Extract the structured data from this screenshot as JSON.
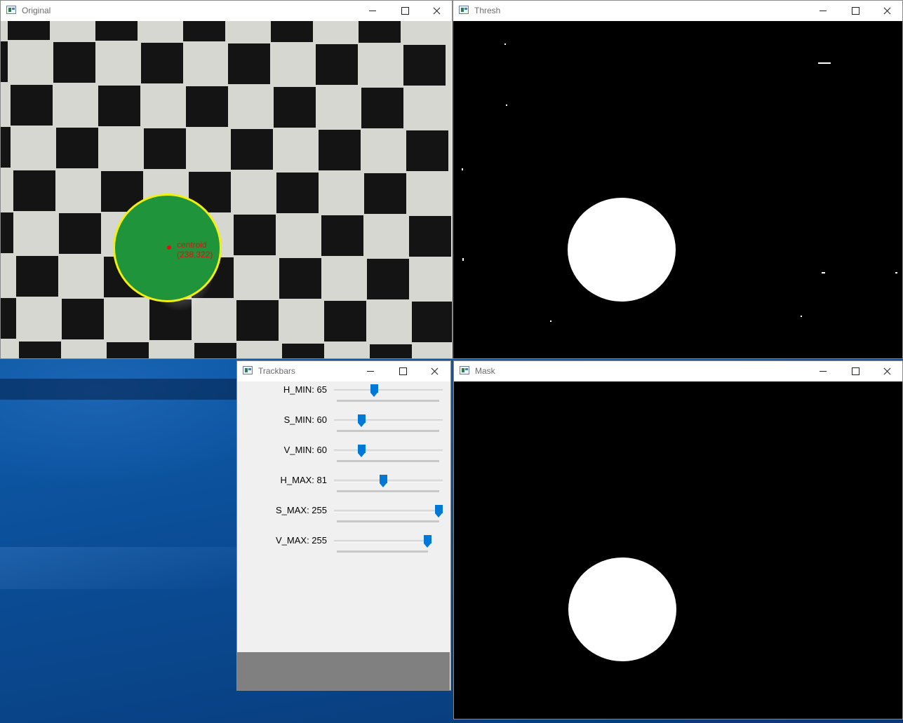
{
  "windows": {
    "original": {
      "title": "Original",
      "centroid_label": "centroid",
      "centroid_coords": "(238,322)"
    },
    "thresh": {
      "title": "Thresh"
    },
    "trackbars": {
      "title": "Trackbars",
      "bars": [
        {
          "label": "H_MIN: 65",
          "value": 65,
          "max": 179
        },
        {
          "label": "S_MIN: 60",
          "value": 60,
          "max": 255
        },
        {
          "label": "V_MIN: 60",
          "value": 60,
          "max": 255
        },
        {
          "label": "H_MAX: 81",
          "value": 81,
          "max": 179
        },
        {
          "label": "S_MAX: 255",
          "value": 255,
          "max": 255
        },
        {
          "label": "V_MAX: 255",
          "value": 255,
          "max": 255
        }
      ]
    },
    "mask": {
      "title": "Mask"
    }
  },
  "colors": {
    "ball": "#20943a",
    "ball_outline": "#f2ee12",
    "centroid": "#e01010",
    "slider_thumb": "#0078d7",
    "desktop": "#0b4e96"
  },
  "icons": {
    "window_icon": "opencv-window-icon",
    "minimize": "minimize-icon",
    "maximize": "maximize-icon",
    "close": "close-icon"
  }
}
